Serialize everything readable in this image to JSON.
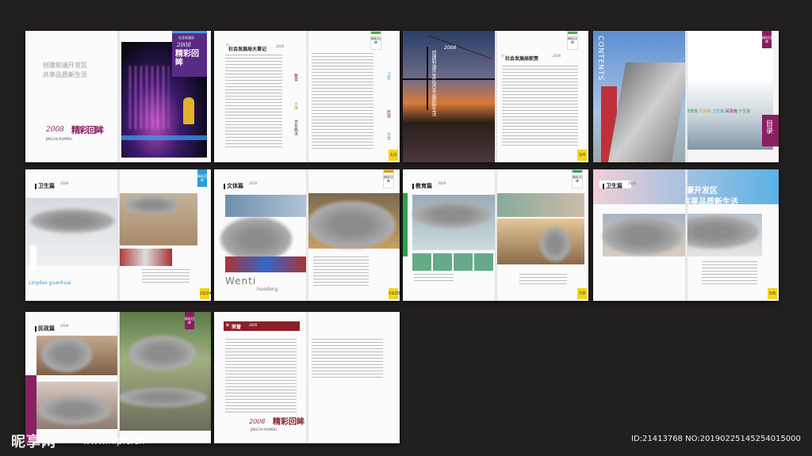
{
  "spread1": {
    "slogan_line1": "创建和谐开发区",
    "slogan_line2": "共享品质新生活",
    "logo_year": "2008",
    "logo_text": "精彩回眸",
    "logo_sub": "JINGCAI HUIMOU",
    "cover_small": "社会发展局",
    "cover_year": "2008",
    "cover_title": "精彩回眸"
  },
  "spread2": {
    "title": "社会发展局大事记",
    "title_year": "2008",
    "side_edu": "教育",
    "side_culture": "文体",
    "side_law": "文化执法",
    "side_health": "卫生",
    "side_civil": "民政",
    "side_plan": "计生",
    "badge": "精彩回眸",
    "page": "1/2"
  },
  "spread3": {
    "vertical_slogan": "创建和谐开发区共享品质新生活",
    "year": "2008",
    "title": "社会发展局职责",
    "title_year": "2008",
    "badge": "精彩回眸",
    "page": "3/4"
  },
  "spread4": {
    "contents": "CONTENTS",
    "badge": "精彩回眸",
    "sections": [
      "教育篇",
      "文体篇",
      "卫生篇",
      "民政篇",
      "计生篇"
    ],
    "mulu": "目录"
  },
  "spread5": {
    "title": "卫生篇",
    "title_year": "2008",
    "badge": "精彩回眸",
    "pinyin": "Lingdao guanhuai",
    "page": "23/24"
  },
  "spread6": {
    "title": "文体篇",
    "title_year": "2008",
    "badge": "精彩回眸",
    "pinyin1": "Wenti",
    "pinyin2": "huodong",
    "page": "19/20"
  },
  "spread7": {
    "title": "教育篇",
    "title_year": "2008",
    "badge": "精彩回眸",
    "page": "7/8"
  },
  "spread8": {
    "title": "卫生篇",
    "title_year": "2008",
    "slogan1": "建设健康开发区",
    "slogan2": "共享品质新生活",
    "page": "5/6"
  },
  "spread9": {
    "title": "民政篇",
    "title_year": "2008",
    "badge": "精彩回眸"
  },
  "spread10": {
    "title": "荣誉",
    "title_year": "2008",
    "logo_year": "2008",
    "logo_text": "精彩回眸",
    "logo_sub": "JINGCAI HUIMOU"
  },
  "watermark": {
    "logo": "昵享网",
    "url": "www.nipic.cn",
    "id": "ID:21413768 NO:20190225145254015000"
  }
}
